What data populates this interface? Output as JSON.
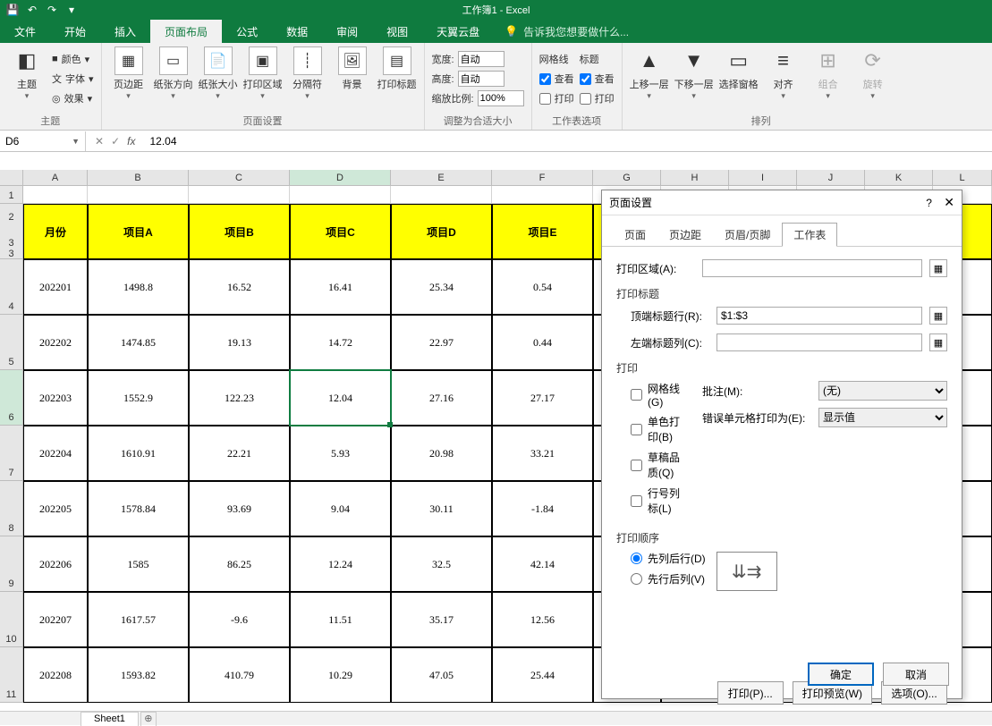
{
  "title": "工作簿1 - Excel",
  "qat": {
    "save": "💾",
    "undo": "↶",
    "redo": "↷"
  },
  "tabs": [
    "文件",
    "开始",
    "插入",
    "页面布局",
    "公式",
    "数据",
    "审阅",
    "视图",
    "天翼云盘"
  ],
  "active_tab": "页面布局",
  "tellme": "告诉我您想要做什么...",
  "ribbon": {
    "themes": {
      "group": "主题",
      "theme": "主题",
      "colors": "颜色",
      "fonts": "字体",
      "effects": "效果"
    },
    "pagesetup": {
      "group": "页面设置",
      "margins": "页边距",
      "orient": "纸张方向",
      "size": "纸张大小",
      "area": "打印区域",
      "breaks": "分隔符",
      "bg": "背景",
      "titles": "打印标题"
    },
    "scale": {
      "group": "调整为合适大小",
      "width_l": "宽度:",
      "height_l": "高度:",
      "scale_l": "缩放比例:",
      "auto": "自动",
      "scale_v": "100%"
    },
    "sheetopt": {
      "group": "工作表选项",
      "gridlines": "网格线",
      "headings": "标题",
      "view": "查看",
      "print": "打印"
    },
    "arrange": {
      "group": "排列",
      "forward": "上移一层",
      "backward": "下移一层",
      "pane": "选择窗格",
      "align": "对齐",
      "group_btn": "组合",
      "rotate": "旋转"
    }
  },
  "namebox": "D6",
  "formula": "12.04",
  "cols": [
    "A",
    "B",
    "C",
    "D",
    "E",
    "F",
    "G",
    "H",
    "I",
    "J",
    "K",
    "L"
  ],
  "header_row": [
    "月份",
    "项目A",
    "项目B",
    "项目C",
    "项目D",
    "项目E"
  ],
  "data_rows": [
    [
      "202201",
      "1498.8",
      "16.52",
      "16.41",
      "25.34",
      "0.54"
    ],
    [
      "202202",
      "1474.85",
      "19.13",
      "14.72",
      "22.97",
      "0.44"
    ],
    [
      "202203",
      "1552.9",
      "122.23",
      "12.04",
      "27.16",
      "27.17"
    ],
    [
      "202204",
      "1610.91",
      "22.21",
      "5.93",
      "20.98",
      "33.21"
    ],
    [
      "202205",
      "1578.84",
      "93.69",
      "9.04",
      "30.11",
      "-1.84"
    ],
    [
      "202206",
      "1585",
      "86.25",
      "12.24",
      "32.5",
      "42.14"
    ],
    [
      "202207",
      "1617.57",
      "-9.6",
      "11.51",
      "35.17",
      "12.56"
    ],
    [
      "202208",
      "1593.82",
      "410.79",
      "10.29",
      "47.05",
      "25.44"
    ]
  ],
  "dialog": {
    "title": "页面设置",
    "help": "?",
    "tabs": [
      "页面",
      "页边距",
      "页眉/页脚",
      "工作表"
    ],
    "active": "工作表",
    "print_area_l": "打印区域(A):",
    "print_titles": "打印标题",
    "top_rows_l": "顶端标题行(R):",
    "top_rows_v": "$1:$3",
    "left_cols_l": "左端标题列(C):",
    "print_section": "打印",
    "gridlines": "网格线(G)",
    "bw": "单色打印(B)",
    "draft": "草稿品质(Q)",
    "rowcol": "行号列标(L)",
    "comments_l": "批注(M):",
    "comments_v": "(无)",
    "errors_l": "错误单元格打印为(E):",
    "errors_v": "显示值",
    "order_section": "打印顺序",
    "down_over": "先列后行(D)",
    "over_down": "先行后列(V)",
    "btn_print": "打印(P)...",
    "btn_preview": "打印预览(W)",
    "btn_options": "选项(O)...",
    "ok": "确定",
    "cancel": "取消"
  },
  "sheet": {
    "name": "Sheet1",
    "add": "⊕"
  }
}
